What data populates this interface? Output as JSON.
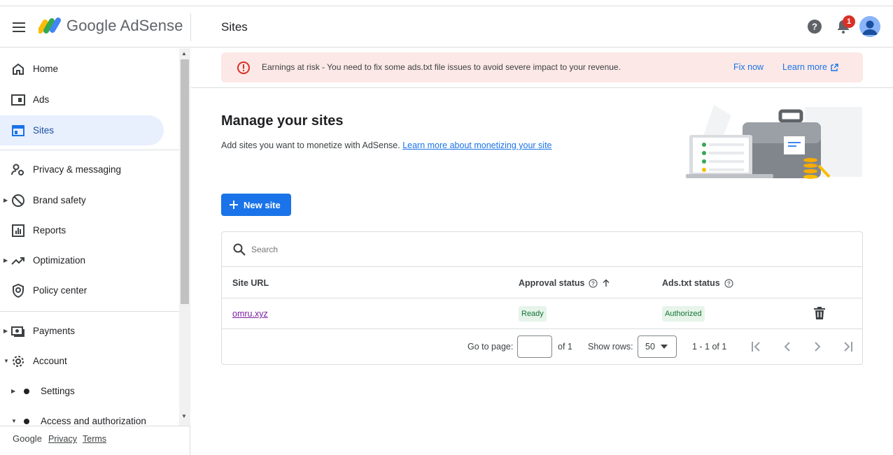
{
  "app": {
    "brand": "Google AdSense",
    "page_title": "Sites",
    "notification_count": "1"
  },
  "sidebar": {
    "items": [
      {
        "label": "Home"
      },
      {
        "label": "Ads"
      },
      {
        "label": "Sites"
      },
      {
        "label": "Privacy & messaging"
      },
      {
        "label": "Brand safety"
      },
      {
        "label": "Reports"
      },
      {
        "label": "Optimization"
      },
      {
        "label": "Policy center"
      },
      {
        "label": "Payments"
      },
      {
        "label": "Account"
      },
      {
        "label": "Settings"
      },
      {
        "label": "Access and authorization"
      }
    ],
    "active": "Sites"
  },
  "footer": {
    "google": "Google",
    "privacy": "Privacy",
    "terms": "Terms"
  },
  "alert": {
    "text": "Earnings at risk - You need to fix some ads.txt file issues to avoid severe impact to your revenue.",
    "fix_label": "Fix now",
    "learn_label": "Learn more"
  },
  "main": {
    "heading": "Manage your sites",
    "subtitle": "Add sites you want to monetize with AdSense.",
    "subtitle_link": "Learn more about monetizing your site",
    "new_site_label": "New site"
  },
  "table": {
    "search_placeholder": "Search",
    "columns": [
      "Site URL",
      "Approval status",
      "Ads.txt status"
    ],
    "rows": [
      {
        "site": "omru.xyz",
        "approval": "Ready",
        "adstxt": "Authorized"
      }
    ]
  },
  "pager": {
    "goto_label": "Go to page:",
    "page_value": "",
    "of_label": "of 1",
    "show_rows_label": "Show rows:",
    "rows_value": "50",
    "range": "1 - 1 of 1"
  },
  "colors": {
    "accent": "#1a73e8",
    "alert_bg": "#fce8e6",
    "alert_icon": "#d93025",
    "chip_bg": "#e6f4ea",
    "chip_text": "#137333"
  }
}
